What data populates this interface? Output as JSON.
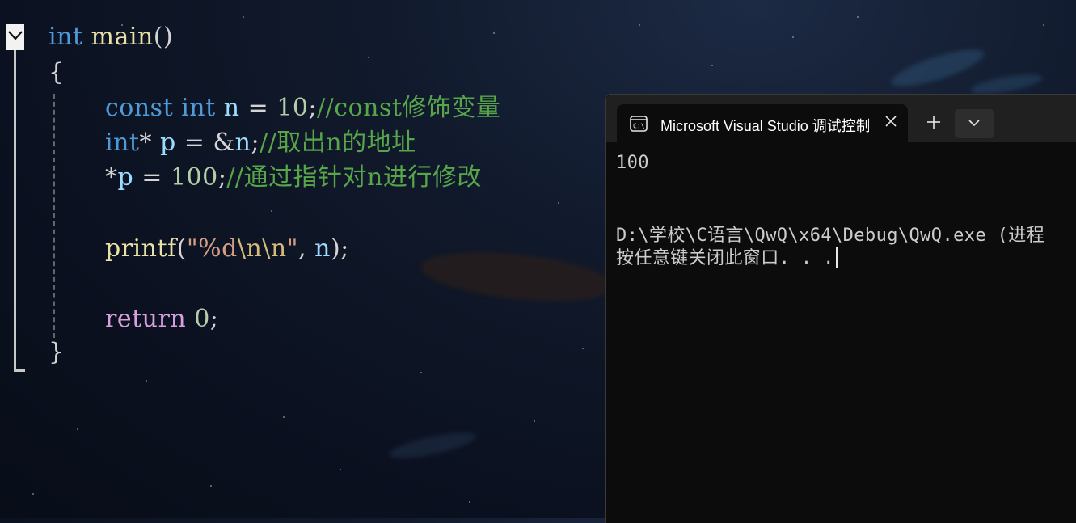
{
  "editor": {
    "line1": {
      "kw": "int",
      "fn": "main",
      "pun": "()"
    },
    "line2": {
      "pun": "{"
    },
    "line3": {
      "kw": "const",
      "kw2": "int",
      "var": "n",
      "op": " = ",
      "num": "10",
      "pun": ";",
      "comment": "//const修饰变量"
    },
    "line4": {
      "kw": "int",
      "op1": "* ",
      "var": "p",
      "op2": " = &",
      "var2": "n",
      "pun": ";",
      "comment": "//取出n的地址"
    },
    "line5": {
      "op1": "*",
      "var": "p",
      "op2": " = ",
      "num": "100",
      "pun": ";",
      "comment": "//通过指针对n进行修改"
    },
    "line6": {
      "fn": "printf",
      "pun1": "(",
      "str1": "\"%d",
      "esc": "\\n\\n",
      "str2": "\"",
      "pun2": ", ",
      "var": "n",
      "pun3": ");"
    },
    "line7": {
      "ret": "return",
      "num": "0",
      "pun": ";"
    },
    "line8": {
      "pun": "}"
    }
  },
  "console": {
    "tab_title": "Microsoft Visual Studio 调试控制台",
    "output_line1": "100",
    "output_line2": "D:\\学校\\C语言\\QwQ\\x64\\Debug\\QwQ.exe (进程",
    "output_line3": "按任意键关闭此窗口. . ."
  },
  "icons": {
    "collapse": "chevron-down-icon",
    "terminal": "terminal-icon",
    "close": "close-icon",
    "new_tab": "plus-icon",
    "dropdown": "chevron-down-icon"
  },
  "colors": {
    "keyword": "#4f9bd9",
    "function": "#e8e1a8",
    "variable": "#9cdcfe",
    "number": "#b5cea8",
    "comment": "#57a64a",
    "string": "#d69d85",
    "console_bg": "#0c0c0c",
    "titlebar_bg": "#202020"
  }
}
